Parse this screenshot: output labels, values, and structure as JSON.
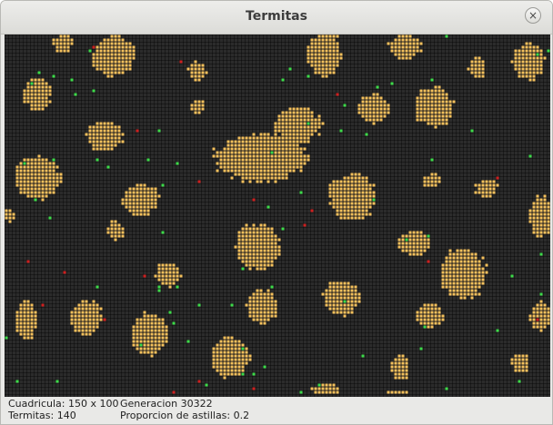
{
  "window": {
    "title": "Termitas",
    "close_icon": "×"
  },
  "simulation": {
    "grid_columns": 150,
    "grid_rows": 100,
    "colors": {
      "background": "#2b2b2b",
      "wood_chip": "#f5c15c",
      "termite_free": "#3ddc4a",
      "termite_carrying": "#cf1f1f"
    }
  },
  "status": {
    "grid_label": "Cuadricula: 150 x 100",
    "termites_label": "Termitas: 140",
    "generation_label": "Generacion 30322",
    "chip_ratio_label": "Proporcion de astillas: 0.2"
  }
}
